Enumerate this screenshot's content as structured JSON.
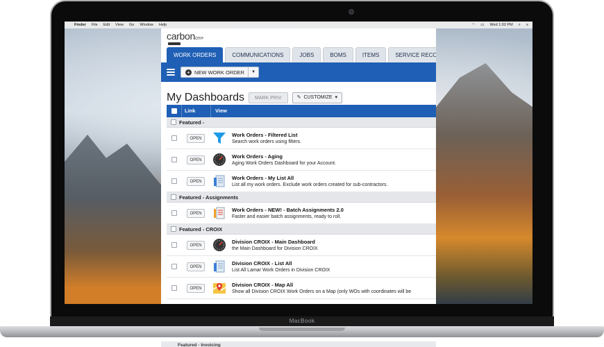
{
  "device": {
    "brand_label": "MacBook"
  },
  "menubar": {
    "items": [
      "Finder",
      "File",
      "Edit",
      "View",
      "Go",
      "Window",
      "Help"
    ],
    "clock": "Wed 1:02 PM"
  },
  "app": {
    "logo": {
      "brand": "carbon",
      "suffix": "cm+"
    },
    "tabs": [
      {
        "label": "WORK ORDERS",
        "active": true
      },
      {
        "label": "COMMUNICATIONS",
        "active": false
      },
      {
        "label": "JOBS",
        "active": false
      },
      {
        "label": "BOMS",
        "active": false
      },
      {
        "label": "ITEMS",
        "active": false
      },
      {
        "label": "SERVICE RECORDS",
        "active": false
      }
    ],
    "toolbar": {
      "new_button": "NEW WORK ORDER"
    },
    "dashboard": {
      "title": "My Dashboards",
      "mark_priv": "MARK PRIV",
      "customize": "CUSTOMIZE"
    },
    "table": {
      "headers": {
        "link": "Link",
        "view": "View"
      },
      "open_label": "OPEN",
      "groups": [
        {
          "name": "Featured -",
          "rows": [
            {
              "icon": "filter-icon",
              "title": "Work Orders - Filtered List",
              "desc": "Search work orders using filters."
            },
            {
              "icon": "gauge-icon",
              "title": "Work Orders - Aging",
              "desc": "Aging Work Orders Dashboard for your Account."
            },
            {
              "icon": "list-icon",
              "title": "Work Orders - My List All",
              "desc": "List all my work orders. Exclude work orders created for sub-contractors."
            }
          ]
        },
        {
          "name": "Featured - Assignments",
          "rows": [
            {
              "icon": "assignment-icon",
              "title": "Work Orders - NEW! - Batch Assignments 2.0",
              "desc": "Faster and easier batch assignments, ready to roll."
            }
          ]
        },
        {
          "name": "Featured - CROIX",
          "rows": [
            {
              "icon": "gauge-icon",
              "title": "Division CROIX - Main Dashboard",
              "desc": "the Main Dashboard for Division CROIX"
            },
            {
              "icon": "list-icon",
              "title": "Division CROIX - List All",
              "desc": "List All Lamar Work Orders in Division CROIX"
            },
            {
              "icon": "map-icon",
              "title": "Division CROIX - Map All",
              "desc": "Show all Division CROIX Work Orders on a Map (only WOs with coordinates will be"
            }
          ]
        }
      ],
      "reflection_group": "Featured - Invoicing"
    }
  }
}
